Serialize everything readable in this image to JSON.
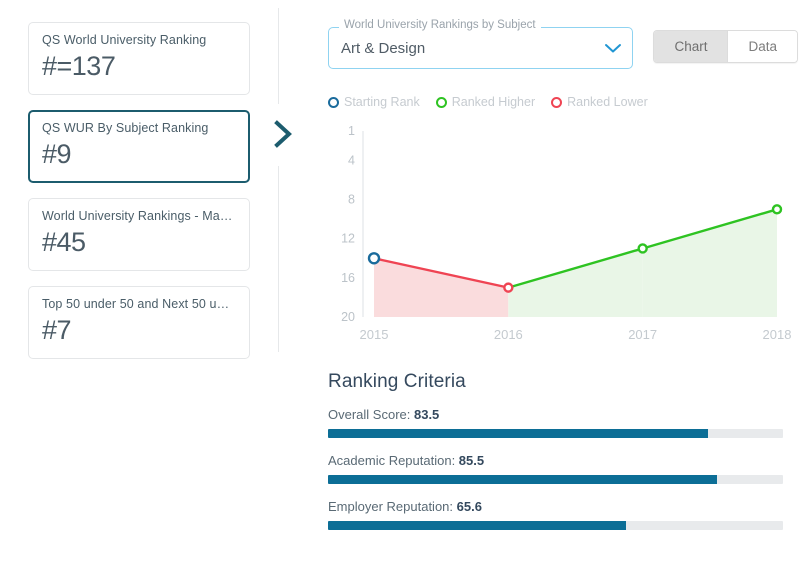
{
  "rank_cards": [
    {
      "title": "QS World University Ranking",
      "value": "#=137",
      "selected": false
    },
    {
      "title": "QS WUR By Subject Ranking",
      "value": "#9",
      "selected": true
    },
    {
      "title": "World University Rankings - Maste...",
      "value": "#45",
      "selected": false
    },
    {
      "title": "Top 50 under 50 and Next 50 und...",
      "value": "#7",
      "selected": false
    }
  ],
  "subject_select": {
    "legend": "World University Rankings by Subject",
    "value": "Art & Design",
    "caret_icon": "chevron-down-icon"
  },
  "view_toggle": {
    "chart_label": "Chart",
    "data_label": "Data",
    "active": "Chart"
  },
  "chevron_next": {
    "icon": "chevron-right-icon",
    "color": "#1c5c6e"
  },
  "legend": [
    {
      "label": "Starting Rank",
      "color": "#1a6b9c"
    },
    {
      "label": "Ranked Higher",
      "color": "#2ec322"
    },
    {
      "label": "Ranked Lower",
      "color": "#ef4453"
    }
  ],
  "chart_data": {
    "type": "line",
    "title": "",
    "xlabel": "",
    "ylabel": "",
    "x": [
      "2015",
      "2016",
      "2017",
      "2018"
    ],
    "categories": [
      "2015",
      "2016",
      "2017",
      "2018"
    ],
    "values": [
      14,
      17,
      13,
      9
    ],
    "series": [
      {
        "name": "Rank",
        "values": [
          14,
          17,
          13,
          9
        ]
      }
    ],
    "ytick_labels": [
      "1",
      "4",
      "8",
      "12",
      "16",
      "20"
    ],
    "ytick_values": [
      1,
      4,
      8,
      12,
      16,
      20
    ],
    "ylim": [
      1,
      20
    ],
    "y_inverted": true,
    "grid": false,
    "legend_position": "top-left",
    "segments": [
      {
        "from": "2015",
        "to": "2016",
        "direction": "lower",
        "color": "#ef4453",
        "fill": "#fadcdd"
      },
      {
        "from": "2016",
        "to": "2017",
        "direction": "higher",
        "color": "#2ec322",
        "fill": "#e9f6e7"
      },
      {
        "from": "2017",
        "to": "2018",
        "direction": "higher",
        "color": "#2ec322",
        "fill": "#e9f6e7"
      }
    ],
    "markers": [
      {
        "x": "2015",
        "y": 14,
        "type": "Starting Rank",
        "color": "#1a6b9c"
      },
      {
        "x": "2016",
        "y": 17,
        "type": "Ranked Lower",
        "color": "#ef4453"
      },
      {
        "x": "2017",
        "y": 13,
        "type": "Ranked Higher",
        "color": "#2ec322"
      },
      {
        "x": "2018",
        "y": 9,
        "type": "Ranked Higher",
        "color": "#2ec322"
      }
    ]
  },
  "criteria": {
    "title": "Ranking Criteria",
    "bar_color": "#0c6e96",
    "track_color": "#e8eaec",
    "items": [
      {
        "name": "Overall Score",
        "label": "Overall Score: ",
        "value": "83.5",
        "percent": 83.5
      },
      {
        "name": "Academic Reputation",
        "label": "Academic Reputation: ",
        "value": "85.5",
        "percent": 85.5
      },
      {
        "name": "Employer Reputation",
        "label": "Employer Reputation: ",
        "value": "65.6",
        "percent": 65.6
      }
    ]
  }
}
